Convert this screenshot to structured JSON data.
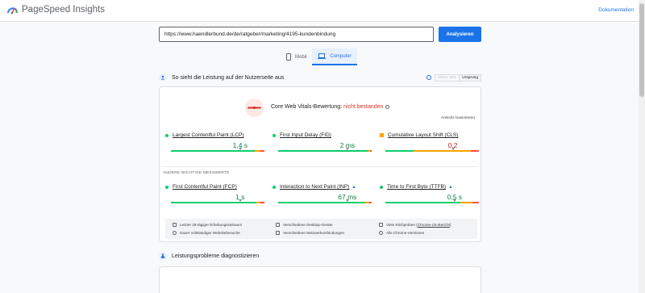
{
  "header": {
    "app_title": "PageSpeed Insights",
    "docs_link": "Dokumentation"
  },
  "search": {
    "url_value": "https://www.haendlerbund.de/de/ratgeber/marketing/4195-kundenbindung",
    "analyze_label": "Analysieren"
  },
  "device_tabs": [
    {
      "label": "Mobil",
      "icon": "phone-icon",
      "active": false
    },
    {
      "label": "Computer",
      "icon": "laptop-icon",
      "active": true
    }
  ],
  "user_experience_section": {
    "title": "So sieht die Leistung auf der Nutzerseite aus",
    "url_toggle": {
      "this_url": "Diese URL",
      "origin": "Ursprung",
      "selected": "Ursprung"
    }
  },
  "core_web_vitals": {
    "logo_icon": "crux-logo",
    "assessment_label": "Core Web Vitals-Bewertung: ",
    "assessment_status": "nicht bestanden",
    "expand_label": "Ansicht maximieren",
    "metrics": [
      {
        "name": "Largest Contentful Paint (LCP)",
        "value": "1,4 s",
        "rating": "good",
        "percentile_position": 0.74,
        "distribution": {
          "good": 0.9,
          "needs_improvement": 0.06
        },
        "experimental": false
      },
      {
        "name": "First Input Delay (FID)",
        "value": "2 ms",
        "rating": "good",
        "percentile_position": 0.74,
        "distribution": {
          "good": 0.96,
          "needs_improvement": 0.02
        },
        "experimental": false
      },
      {
        "name": "Cumulative Layout Shift (CLS)",
        "value": "0,2",
        "rating": "needs-improvement",
        "percentile_position": 0.72,
        "distribution": {
          "good": 0.3,
          "needs_improvement": 0.61
        },
        "experimental": false
      }
    ]
  },
  "other_metrics": {
    "title": "ANDERE WICHTIGE MESSWERTE",
    "metrics": [
      {
        "name": "First Contentful Paint (FCP)",
        "value": "1 s",
        "rating": "good",
        "percentile_position": 0.74,
        "distribution": {
          "good": 0.91,
          "needs_improvement": 0.05
        },
        "experimental": false
      },
      {
        "name": "Interaction to Next Paint (INP)",
        "value": "67 ms",
        "rating": "good",
        "percentile_position": 0.74,
        "distribution": {
          "good": 0.93,
          "needs_improvement": 0.04
        },
        "experimental": true
      },
      {
        "name": "Time to First Byte (TTFB)",
        "value": "0,5 s",
        "rating": "good",
        "percentile_position": 0.74,
        "distribution": {
          "good": 0.8,
          "needs_improvement": 0.13
        },
        "experimental": true
      }
    ]
  },
  "data_info": {
    "period": "Letzter 28-tägiger Erhebungszeitraum",
    "devices": "Verschiedene Desktop-Geräte",
    "samples_prefix": "Viele Stichproben (",
    "samples_link": "Chrome-UX-Bericht",
    "samples_suffix": ")",
    "visit_duration": "Dauer vollständiger Websitebesuche",
    "connections": "Verschiedene Netzwerkverbindungen",
    "chrome_versions": "Alle Chrome-Versionen"
  },
  "diagnose_section": {
    "title": "Leistungsprobleme diagnostizieren"
  },
  "colors": {
    "good": "#0cce6b",
    "needs_improvement": "#ffa400",
    "poor": "#ff4e42",
    "accent": "#1a73e8",
    "fail": "#d93025"
  }
}
